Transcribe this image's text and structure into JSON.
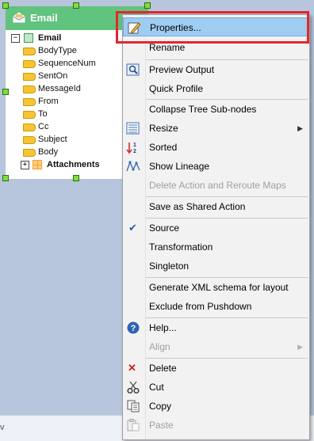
{
  "status_bar": {
    "partial_text": "v"
  },
  "node": {
    "title": "Email",
    "root": "Email",
    "children": [
      "BodyType",
      "SequenceNum",
      "SentOn",
      "MessageId",
      "From",
      "To",
      "Cc",
      "Subject",
      "Body"
    ],
    "collection": "Attachments",
    "header_color": "#60c37e"
  },
  "menu": {
    "items": [
      {
        "label": "Properties...",
        "icon": "properties-icon",
        "highlighted": true
      },
      {
        "label": "Rename"
      },
      {
        "label": "Preview Output",
        "icon": "preview-icon"
      },
      {
        "label": "Quick Profile"
      },
      {
        "label": "Collapse Tree Sub-nodes"
      },
      {
        "label": "Resize",
        "icon": "resize-icon",
        "submenu": true
      },
      {
        "label": "Sorted",
        "icon": "sort-icon"
      },
      {
        "label": "Show Lineage",
        "icon": "lineage-icon"
      },
      {
        "label": "Delete Action and Reroute Maps",
        "disabled": true
      },
      {
        "label": "Save as Shared Action"
      },
      {
        "label": "Source",
        "icon": "check-icon",
        "checked": true
      },
      {
        "label": "Transformation"
      },
      {
        "label": "Singleton"
      },
      {
        "label": "Generate XML schema for layout"
      },
      {
        "label": "Exclude from Pushdown"
      },
      {
        "label": "Help...",
        "icon": "help-icon"
      },
      {
        "label": "Align",
        "disabled": true,
        "submenu": true
      },
      {
        "label": "Delete",
        "icon": "delete-icon"
      },
      {
        "label": "Cut",
        "icon": "cut-icon"
      },
      {
        "label": "Copy",
        "icon": "copy-icon"
      },
      {
        "label": "Paste",
        "icon": "paste-icon",
        "disabled": true
      }
    ],
    "highlight_color": "#9fcdf2",
    "annotation_color": "#e3262f"
  }
}
